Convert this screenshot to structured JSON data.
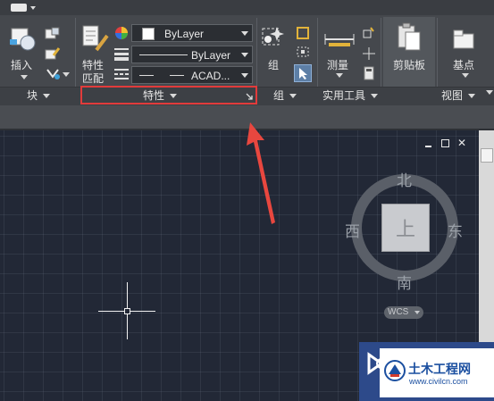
{
  "ribbon": {
    "insert_label": "插入",
    "match_props_label_1": "特性",
    "match_props_label_2": "匹配",
    "color_value": "ByLayer",
    "linetype_value": "ByLayer",
    "lineweight_value": "ACAD...",
    "group_label": "组",
    "measure_label": "测量",
    "clipboard_label": "剪贴板",
    "base_label": "基点",
    "panels": {
      "block": "块",
      "properties": "特性",
      "group": "组",
      "utilities": "实用工具",
      "view": "视图"
    }
  },
  "viewcube": {
    "north": "北",
    "south": "南",
    "east": "东",
    "west": "西",
    "top": "上",
    "wcs": "WCS"
  },
  "watermark": {
    "title": "土木工程网",
    "url": "www.civilcn.com"
  },
  "colors": {
    "ribbon_bg": "#45484d",
    "canvas_bg": "#222836",
    "highlight_red": "#e23b3b",
    "arrow_red": "#e8473f"
  }
}
